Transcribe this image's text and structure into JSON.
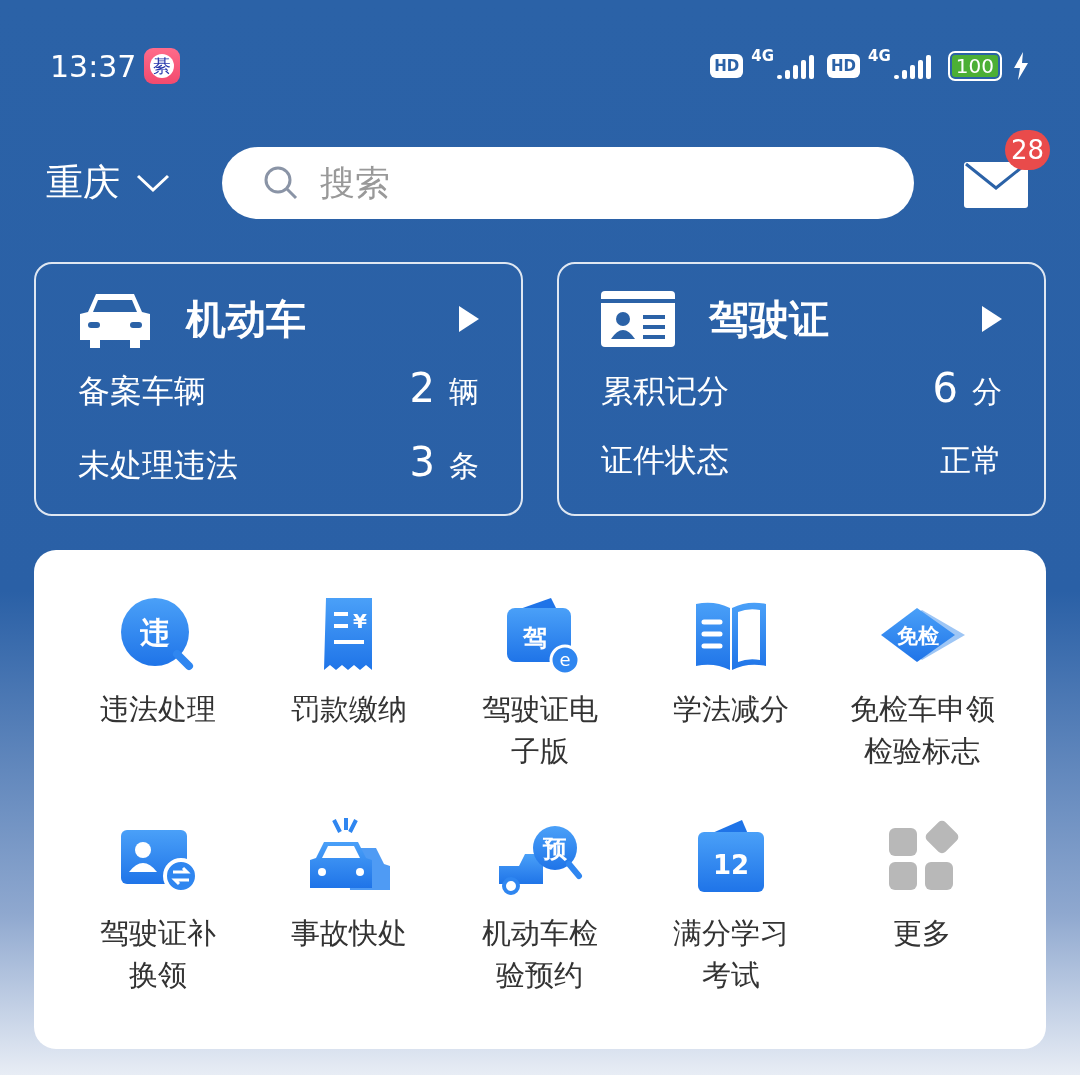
{
  "status_bar": {
    "time": "13:37",
    "app_badge": "綦",
    "sims": [
      {
        "hd": "HD",
        "network": "4G"
      },
      {
        "hd": "HD",
        "network": "4G"
      }
    ],
    "battery": "100"
  },
  "header": {
    "city": "重庆",
    "search": {
      "placeholder": "搜索"
    },
    "messages": {
      "badge": "28"
    }
  },
  "cards": [
    {
      "kind": "vehicle",
      "title": "机动车",
      "rows": [
        {
          "label": "备案车辆",
          "value": "2",
          "unit": "辆"
        },
        {
          "label": "未处理违法",
          "value": "3",
          "unit": "条"
        }
      ]
    },
    {
      "kind": "license",
      "title": "驾驶证",
      "rows": [
        {
          "label": "累积记分",
          "value": "6",
          "unit": "分"
        },
        {
          "label": "证件状态",
          "value": "正常"
        }
      ]
    }
  ],
  "services": [
    {
      "kind": "magnifier",
      "glyph": "违",
      "label": [
        "违法处理"
      ]
    },
    {
      "kind": "receipt",
      "glyph": "¥",
      "label": [
        "罚款缴纳"
      ]
    },
    {
      "kind": "ecard",
      "glyph": "驾",
      "sub_glyph": "e",
      "label": [
        "驾驶证电",
        "子版"
      ]
    },
    {
      "kind": "book",
      "label": [
        "学法减分"
      ]
    },
    {
      "kind": "diamond",
      "glyph": "免检",
      "label": [
        "免检车申领",
        "检验标志"
      ]
    },
    {
      "kind": "renew",
      "label": [
        "驾驶证补",
        "换领"
      ]
    },
    {
      "kind": "crash",
      "label": [
        "事故快处"
      ]
    },
    {
      "kind": "truck",
      "glyph": "预",
      "label": [
        "机动车检",
        "验预约"
      ]
    },
    {
      "kind": "folder",
      "glyph": "12",
      "label": [
        "满分学习",
        "考试"
      ]
    },
    {
      "kind": "more",
      "label": [
        "更多"
      ]
    }
  ]
}
